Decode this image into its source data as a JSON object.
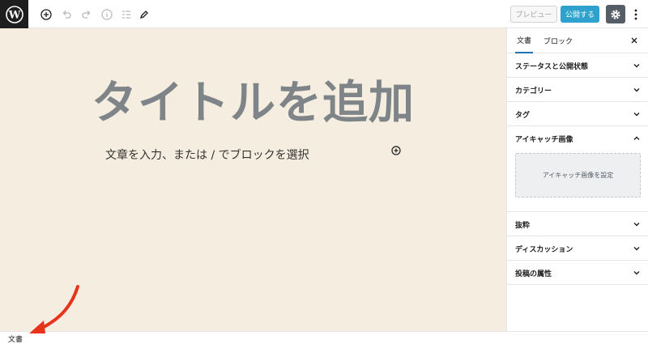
{
  "toolbar": {
    "preview_label": "プレビュー",
    "publish_label": "公開する",
    "icons": [
      "wordpress-icon",
      "add-block-icon",
      "undo-icon",
      "redo-icon",
      "info-icon",
      "list-view-icon",
      "edit-icon",
      "gear-icon",
      "more-vertical-icon"
    ]
  },
  "editor": {
    "title_placeholder": "タイトルを追加",
    "body_placeholder": "文章を入力、または / でブロックを選択"
  },
  "sidebar": {
    "tabs": [
      {
        "label": "文書",
        "active": true
      },
      {
        "label": "ブロック",
        "active": false
      }
    ],
    "panels": [
      {
        "label": "ステータスと公開状態",
        "open": false
      },
      {
        "label": "カテゴリー",
        "open": false
      },
      {
        "label": "タグ",
        "open": false
      },
      {
        "label": "アイキャッチ画像",
        "open": true
      },
      {
        "label": "抜粋",
        "open": false
      },
      {
        "label": "ディスカッション",
        "open": false
      },
      {
        "label": "投稿の属性",
        "open": false
      }
    ],
    "featured_image_button": "アイキャッチ画像を設定"
  },
  "footer": {
    "breadcrumb": "文書"
  },
  "colors": {
    "canvas_bg": "#f5eee0",
    "title": "#7e8487",
    "publish": "#2ea2cc",
    "annotation_arrow": "#e8331c"
  }
}
